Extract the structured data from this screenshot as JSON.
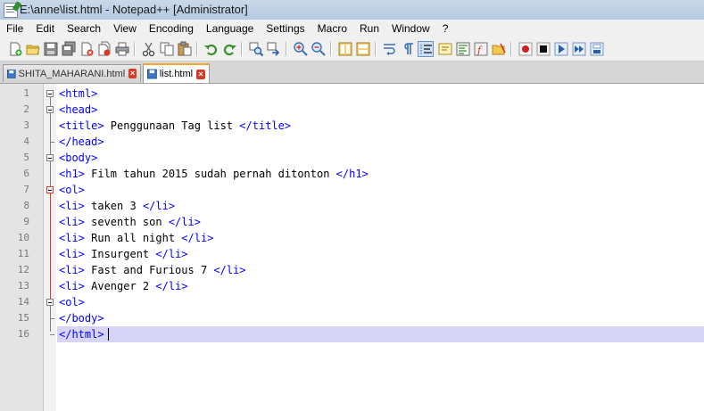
{
  "window": {
    "title": "E:\\anne\\list.html - Notepad++ [Administrator]"
  },
  "menu": [
    "File",
    "Edit",
    "Search",
    "View",
    "Encoding",
    "Language",
    "Settings",
    "Macro",
    "Run",
    "Window",
    "?"
  ],
  "toolbar": {
    "icons": [
      "new-file-icon",
      "open-file-icon",
      "save-icon",
      "save-all-icon",
      "close-icon",
      "close-all-icon",
      "print-icon",
      "cut-icon",
      "copy-icon",
      "paste-icon",
      "undo-icon",
      "redo-icon",
      "find-icon",
      "replace-icon",
      "zoom-in-icon",
      "zoom-out-icon",
      "sync-vertical-icon",
      "sync-horizontal-icon",
      "word-wrap-icon",
      "show-all-chars-icon",
      "indent-guide-icon",
      "user-language-icon",
      "doc-map-icon",
      "function-list-icon",
      "record-macro-icon",
      "stop-record-icon",
      "play-macro-icon",
      "run-macro-multiple-icon",
      "save-macro-icon"
    ]
  },
  "tabs": [
    {
      "label": "SHITA_MAHARANI.html",
      "active": false
    },
    {
      "label": "list.html",
      "active": true
    }
  ],
  "editor": {
    "lines": [
      {
        "n": "1",
        "text": "<html>"
      },
      {
        "n": "2",
        "text": "<head>"
      },
      {
        "n": "3",
        "text": "<title> Penggunaan Tag list </title>"
      },
      {
        "n": "4",
        "text": "</head>"
      },
      {
        "n": "5",
        "text": "<body>"
      },
      {
        "n": "6",
        "text": "<h1> Film tahun 2015 sudah pernah ditonton </h1>"
      },
      {
        "n": "7",
        "text": "<ol>"
      },
      {
        "n": "8",
        "text": "<li> taken 3 </li>"
      },
      {
        "n": "9",
        "text": "<li> seventh son </li>"
      },
      {
        "n": "10",
        "text": "<li> Run all night </li>"
      },
      {
        "n": "11",
        "text": "<li> Insurgent </li>"
      },
      {
        "n": "12",
        "text": "<li> Fast and Furious 7 </li>"
      },
      {
        "n": "13",
        "text": "<li> Avenger 2 </li>"
      },
      {
        "n": "14",
        "text": "<ol>"
      },
      {
        "n": "15",
        "text": "</body>"
      },
      {
        "n": "16",
        "text": "</html>"
      }
    ],
    "current_line": 16
  },
  "colors": {
    "tag": "#0000ff",
    "text": "#000000",
    "current_line": "#d8d4f6",
    "tab_accent": "#f5a637"
  }
}
